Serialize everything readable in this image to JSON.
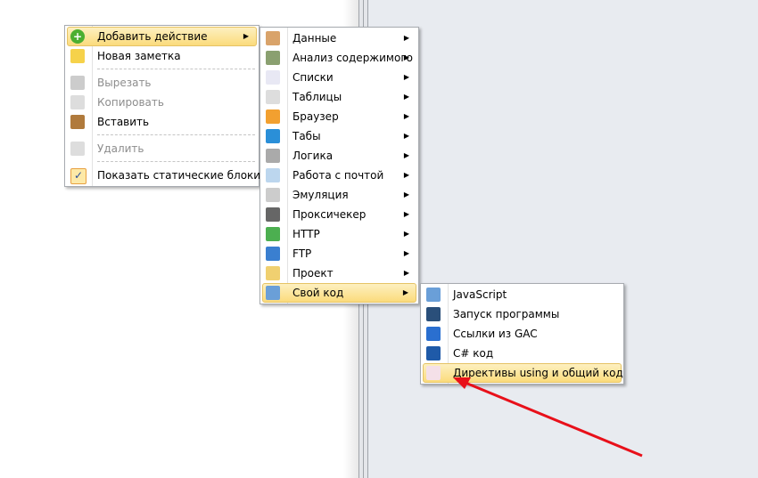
{
  "main_menu": [
    {
      "label": "Добавить действие",
      "icon": "add-icon",
      "submenu": true,
      "highlighted": true
    },
    {
      "label": "Новая заметка",
      "icon": "note-icon"
    },
    {
      "separator": true
    },
    {
      "label": "Вырезать",
      "icon": "cut-icon",
      "disabled": true
    },
    {
      "label": "Копировать",
      "icon": "copy-icon",
      "disabled": true
    },
    {
      "label": "Вставить",
      "icon": "paste-icon"
    },
    {
      "separator": true
    },
    {
      "label": "Удалить",
      "icon": "delete-icon",
      "disabled": true
    },
    {
      "separator": true
    },
    {
      "label": "Показать статические блоки",
      "icon": "check-icon",
      "checked": true
    }
  ],
  "actions_menu": [
    {
      "label": "Данные",
      "icon": "user-icon"
    },
    {
      "label": "Анализ содержимого",
      "icon": "analysis-icon"
    },
    {
      "label": "Списки",
      "icon": "list-icon"
    },
    {
      "label": "Таблицы",
      "icon": "table-icon"
    },
    {
      "label": "Браузер",
      "icon": "browser-icon"
    },
    {
      "label": "Табы",
      "icon": "tabs-icon"
    },
    {
      "label": "Логика",
      "icon": "logic-icon"
    },
    {
      "label": "Работа с почтой",
      "icon": "mail-icon"
    },
    {
      "label": "Эмуляция",
      "icon": "mouse-icon"
    },
    {
      "label": "Проксичекер",
      "icon": "proxy-icon"
    },
    {
      "label": "HTTP",
      "icon": "http-icon"
    },
    {
      "label": "FTP",
      "icon": "ftp-icon"
    },
    {
      "label": "Проект",
      "icon": "project-icon"
    },
    {
      "label": "Свой код",
      "icon": "script-icon",
      "highlighted": true
    }
  ],
  "code_menu": [
    {
      "label": "JavaScript",
      "icon": "javascript-icon"
    },
    {
      "label": "Запуск программы",
      "icon": "console-icon"
    },
    {
      "label": "Ссылки из GAC",
      "icon": "book-icon"
    },
    {
      "label": "C# код",
      "icon": "csharp-icon"
    },
    {
      "label": "Директивы using и общий код",
      "icon": "directives-icon",
      "highlighted": true
    }
  ],
  "colors": {
    "highlight": "#fbdb7c",
    "annotation_arrow": "#e8101a",
    "canvas": "#e8ebf0"
  }
}
